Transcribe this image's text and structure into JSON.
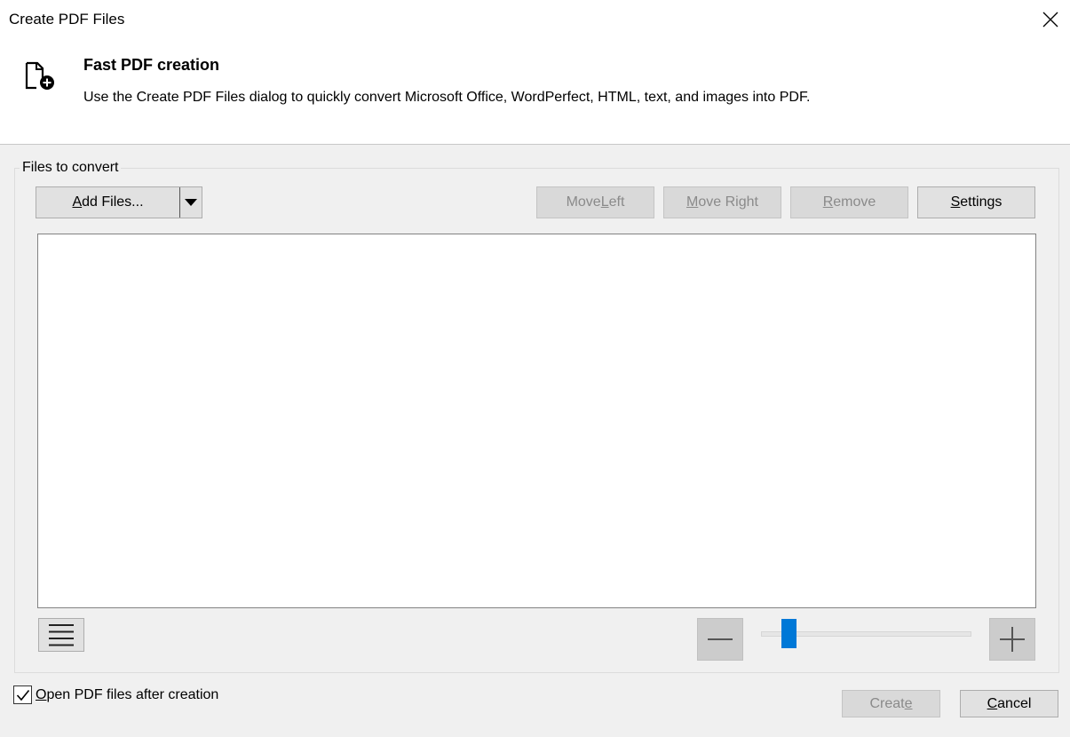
{
  "window": {
    "title": "Create PDF Files",
    "close_icon": "close-icon"
  },
  "header": {
    "icon": "pdf-add-file-icon",
    "title": "Fast PDF creation",
    "description": "Use the Create PDF Files dialog to quickly convert Microsoft Office, WordPerfect, HTML, text, and images into PDF."
  },
  "files_group": {
    "legend": "Files to convert",
    "add_files": {
      "label_accel": "A",
      "label_rest": "dd Files...",
      "arrow_icon": "dropdown-arrow-icon"
    },
    "buttons": {
      "move_left": {
        "pre": "Move ",
        "accel": "L",
        "post": "eft",
        "disabled": true
      },
      "move_right": {
        "pre": "",
        "accel": "M",
        "post": "ove Right",
        "disabled": true
      },
      "remove": {
        "pre": "",
        "accel": "R",
        "post": "emove",
        "disabled": true
      },
      "settings": {
        "pre": "",
        "accel": "S",
        "post": "ettings",
        "disabled": false
      }
    },
    "file_list": [],
    "view_menu_icon": "hamburger-menu-icon",
    "zoom": {
      "minus_icon": "minus-icon",
      "plus_icon": "plus-icon",
      "level_fraction": 0.1
    }
  },
  "footer": {
    "open_after_creation": {
      "checked": true,
      "accel": "O",
      "label_rest": "pen PDF files after creation"
    },
    "create": {
      "pre": "Creat",
      "accel": "e",
      "post": "",
      "disabled": true
    },
    "cancel": {
      "pre": "",
      "accel": "C",
      "post": "ancel",
      "disabled": false
    }
  },
  "colors": {
    "slider_thumb": "#0078d7",
    "dialog_bg": "#f0f0f0",
    "button_bg": "#e1e1e1",
    "disabled_text": "#8a8a8a"
  }
}
